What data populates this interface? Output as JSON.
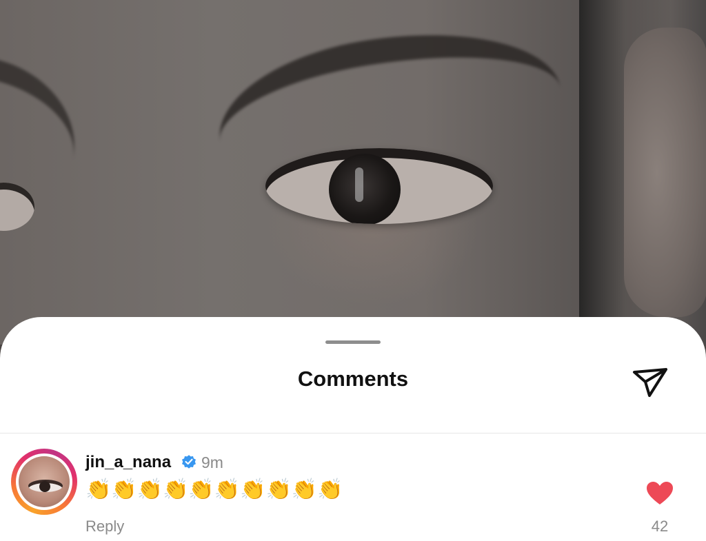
{
  "sheet": {
    "title": "Comments",
    "send_icon": "paper-plane-icon"
  },
  "comment": {
    "username": "jin_a_nana",
    "verified": true,
    "time_ago": "9m",
    "text": "👏👏👏👏👏👏👏👏👏👏",
    "reply_label": "Reply",
    "liked": true,
    "like_count": "42",
    "like_color": "#ed4956",
    "verified_color": "#3897f0"
  }
}
